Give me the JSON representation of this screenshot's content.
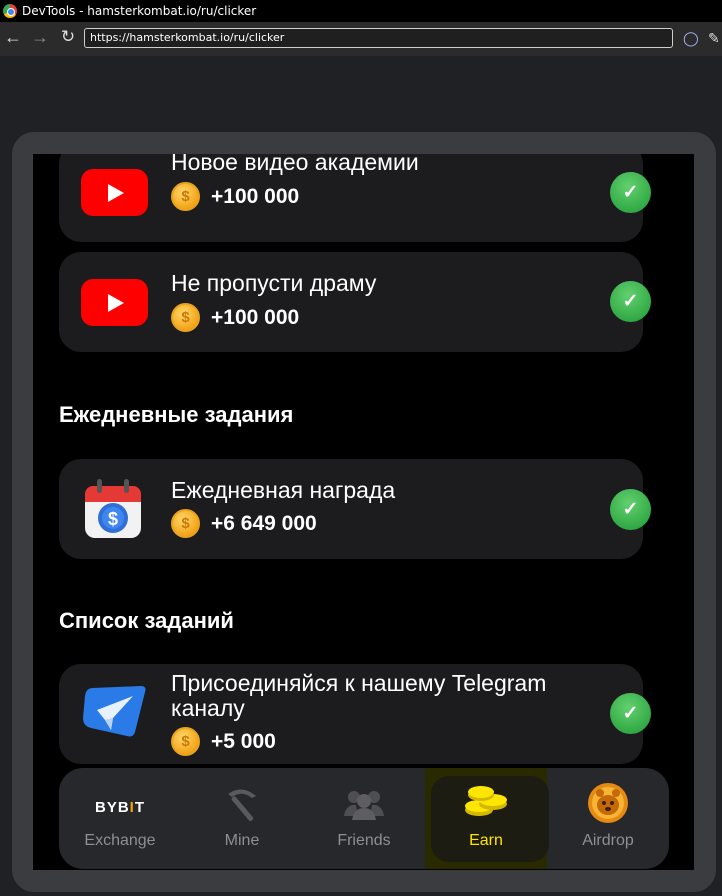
{
  "window": {
    "title": "DevTools - hamsterkombat.io/ru/clicker",
    "url": "https://hamsterkombat.io/ru/clicker"
  },
  "tasks_top": [
    {
      "title": "Новое видео академии",
      "reward": "+100 000",
      "done": true,
      "icon": "youtube-icon"
    },
    {
      "title": "Не пропусти драму",
      "reward": "+100 000",
      "done": true,
      "icon": "youtube-icon"
    }
  ],
  "daily": {
    "heading": "Ежедневные задания",
    "task": {
      "title": "Ежедневная награда",
      "reward": "+6 649 000",
      "done": true,
      "icon": "calendar-coin-icon"
    }
  },
  "task_list": {
    "heading": "Список заданий",
    "task": {
      "title_line1": "Присоединяйся к нашему Telegram",
      "title_line2": "каналу",
      "reward": "+5 000",
      "done": true,
      "icon": "telegram-icon"
    }
  },
  "coin_symbol": "$",
  "check_symbol": "✓",
  "bottom_nav": {
    "items": [
      {
        "label": "Exchange",
        "icon": "bybit-logo",
        "logo_text_a": "BYB",
        "logo_text_b": "I",
        "logo_text_c": "T"
      },
      {
        "label": "Mine",
        "icon": "pickaxe-icon"
      },
      {
        "label": "Friends",
        "icon": "friends-icon"
      },
      {
        "label": "Earn",
        "icon": "coins-icon",
        "active": true
      },
      {
        "label": "Airdrop",
        "icon": "hamster-coin-icon"
      }
    ]
  },
  "colors": {
    "accent": "#ffe600",
    "success": "#34b04a",
    "youtube": "#ff0000"
  }
}
